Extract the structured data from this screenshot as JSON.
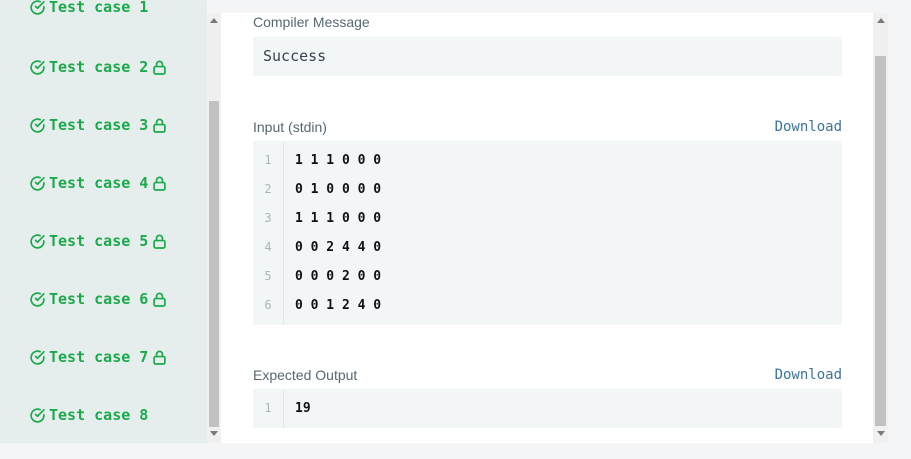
{
  "sidebar": {
    "partial_label": "Test case 1",
    "items": [
      {
        "label": "Test case 2",
        "locked": true
      },
      {
        "label": "Test case 3",
        "locked": true
      },
      {
        "label": "Test case 4",
        "locked": true
      },
      {
        "label": "Test case 5",
        "locked": true
      },
      {
        "label": "Test case 6",
        "locked": true
      },
      {
        "label": "Test case 7",
        "locked": true
      },
      {
        "label": "Test case 8",
        "locked": false
      }
    ]
  },
  "compiler": {
    "label": "Compiler Message",
    "message": "Success"
  },
  "input": {
    "label": "Input (stdin)",
    "download": "Download",
    "lines": [
      {
        "n": "1",
        "text": "1 1 1 0 0 0"
      },
      {
        "n": "2",
        "text": "0 1 0 0 0 0"
      },
      {
        "n": "3",
        "text": "1 1 1 0 0 0"
      },
      {
        "n": "4",
        "text": "0 0 2 4 4 0"
      },
      {
        "n": "5",
        "text": "0 0 0 2 0 0"
      },
      {
        "n": "6",
        "text": "0 0 1 2 4 0"
      }
    ]
  },
  "expected": {
    "label": "Expected Output",
    "download": "Download",
    "lines": [
      {
        "n": "1",
        "text": "19"
      }
    ]
  },
  "colors": {
    "success": "#1ba94c",
    "link": "#39749a"
  }
}
